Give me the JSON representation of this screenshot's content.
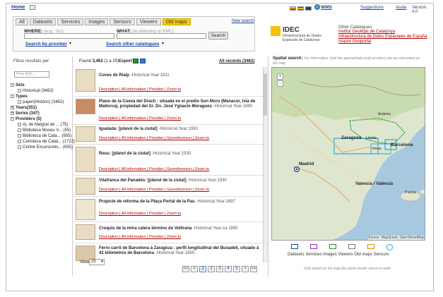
{
  "header": {
    "home": "Home",
    "wms": "WMS",
    "suggestions": "Suggestions",
    "help": "Ajuda",
    "version": "Version: 4.0"
  },
  "search": {
    "tabs": [
      {
        "label": "All",
        "active": false
      },
      {
        "label": "Datasets",
        "active": false
      },
      {
        "label": "Services",
        "active": false
      },
      {
        "label": "Images",
        "active": false
      },
      {
        "label": "Sensors",
        "active": false
      },
      {
        "label": "Viewers",
        "active": false
      },
      {
        "label": "Old maps",
        "active": true
      }
    ],
    "new_search": "New search",
    "where_label": "WHERE:",
    "where_hint": "(e.g.: Vic)",
    "what_label": "WHAT:",
    "what_hint": "(ie planning or KML)",
    "search_button": "Search",
    "by_provider": "Search by provider",
    "other_catalogues": "Search other catalogues"
  },
  "idec": {
    "name": "IDEC",
    "subtitle1": "Infraestructura de Dades",
    "subtitle2": "Espacials de Catalunya",
    "other_title": "Other Catalogues:",
    "links": [
      "Institut Geològic de Catalunya",
      "Infraestructura de Datos Espaciales de España",
      "Inspire Geoportal"
    ]
  },
  "filters": {
    "title": "Filtrar resultats per:",
    "free_text_placeholder": "Free text...",
    "sets_label": "Sets",
    "sets_item": "Historical (3462)",
    "types_label": "Types",
    "types_item": "paper(Històric) (3462)",
    "years_label": "Years(351)",
    "series_label": "Series (347)",
    "providers_label": "Providers (5)",
    "providers": [
      {
        "name": "Aj. de Malgrat de ...",
        "count": "(75)"
      },
      {
        "name": "Biblioteca Museu V...",
        "count": "(55)"
      },
      {
        "name": "Biblioteca de Cata...",
        "count": "(955)"
      },
      {
        "name": "Cartoteca de Catal...",
        "count": "(1722)"
      },
      {
        "name": "Centre Excursionis...",
        "count": "(655)"
      }
    ]
  },
  "results": {
    "found_prefix": "Found",
    "found_count": "3,462",
    "found_range": "(1 a 25)",
    "export_label": "Export",
    "all_records": "All records (3462)",
    "items": [
      {
        "title": "Coves de Rialp",
        "meta": "-Historical.Year:1911",
        "links": "Description | All information | Provider | Zoom to"
      },
      {
        "title": "Plano de la Cueva del Drach : situada en el predio Son Moro (Manacor, Isla de Mallorca), propiedad del Sr. Dn. José Ygnacio Moragues",
        "meta": "-Historical.Year:1880",
        "links": "Description | All information | Provider | Zoom to"
      },
      {
        "title": "Igualada: [plànol de la ciutat]",
        "meta": "-Historical.Year:1930",
        "links": "Description | All information | Provider | Georeferencer | Zoom to"
      },
      {
        "title": "Reus: [plànol de la ciutat]",
        "meta": "-Historical.Year:1930",
        "links": "Description | All information | Provider | Georeferencer | Zoom to"
      },
      {
        "title": "Vilafranca del Panadés: [plànol de la ciutat]",
        "meta": "-Historical.Year:1930",
        "links": "Description | All information | Provider | Georeferencer | Zoom to"
      },
      {
        "title": "Projecte de reforma de la Plaça Portal de la Pau",
        "meta": "-Historical.Year:1897",
        "links": "Description | All information | Provider | Zoom to"
      },
      {
        "title": "Croquis de la mina calera término de Vellirana",
        "meta": "-Historical.Year:ca 1890",
        "links": "Description | All information | Provider | Zoom to"
      },
      {
        "title": "Ferro carril de Barcelona à Zaragoza : perfil longitudinal del Buxadell, situado à 42 kilómetros de Barcelona",
        "meta": "-Historical.Year:1855",
        "links": "Description | All information | Provider | Zoom to"
      }
    ],
    "view_label": "View",
    "view_value": "25",
    "pages": [
      "<<",
      "<",
      "1",
      "2",
      "3",
      "4",
      "5",
      ">",
      ">>"
    ],
    "current_page": "1"
  },
  "map": {
    "title": "Spatial search:",
    "hint": "For information, click the approximate point at which you are interested on the map",
    "zoom_in": "+",
    "zoom_out": "-",
    "labels": [
      "Zaragoza",
      "Lleida",
      "Barcelona",
      "Reus",
      "Madrid",
      "Valencia / València",
      "Palma",
      "Andorra"
    ],
    "attribution": "Source: MapQuest, OpenStreetMap",
    "legend": [
      "Datasets",
      "Services",
      "Images",
      "Viewers",
      "Old maps",
      "Sensors"
    ],
    "legend_colors": [
      "#23439a",
      "#8b2fb0",
      "#2f8b3a",
      "#7a7a7a",
      "#d09000",
      "#2aa8d8"
    ],
    "note": "Only drawn on the map the same results shown in table"
  }
}
